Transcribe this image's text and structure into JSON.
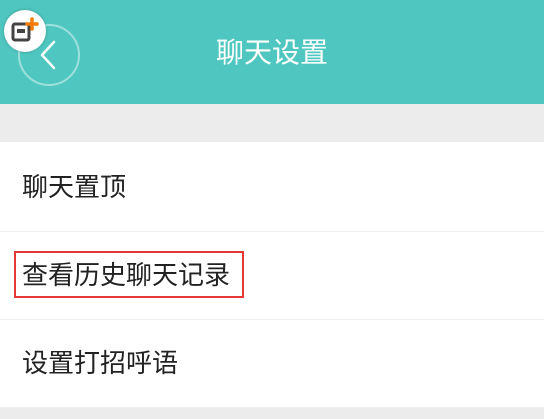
{
  "header": {
    "title": "聊天设置",
    "back_icon": "chevron-left-icon",
    "badge_icon": "add-window-icon"
  },
  "colors": {
    "header_bg": "#4fc7c0",
    "section_bg": "#ececec",
    "highlight_border": "#e53935",
    "badge_orange": "#f57c00"
  },
  "settings": {
    "items": [
      {
        "label": "聊天置顶"
      },
      {
        "label": "查看历史聊天记录"
      },
      {
        "label": "设置打招呼语"
      }
    ]
  }
}
